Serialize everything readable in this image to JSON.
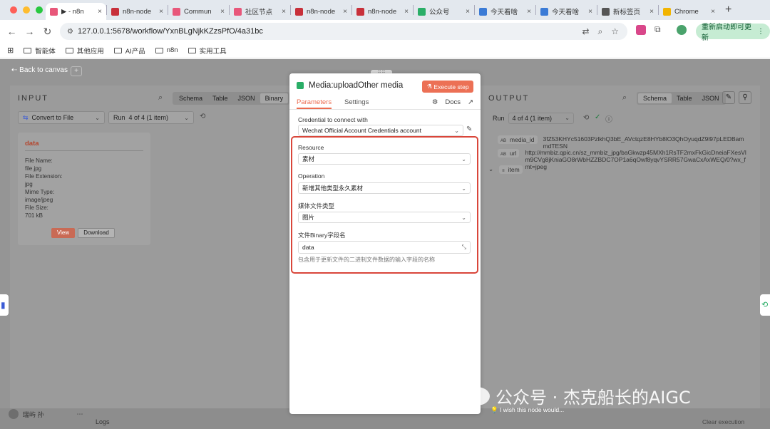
{
  "browser": {
    "tabs": [
      {
        "label": "▶ - n8n",
        "active": true,
        "icon": "n8n-icon"
      },
      {
        "label": "n8n-node",
        "active": false,
        "icon": "n8n-red-icon"
      },
      {
        "label": "Commun",
        "active": false,
        "icon": "n8n-icon"
      },
      {
        "label": "社区节点",
        "active": false,
        "icon": "n8n-icon"
      },
      {
        "label": "n8n-node",
        "active": false,
        "icon": "n8n-red-icon"
      },
      {
        "label": "n8n-node",
        "active": false,
        "icon": "n8n-red-icon"
      },
      {
        "label": "公众号",
        "active": false,
        "icon": "recycle-icon"
      },
      {
        "label": "今天看啥",
        "active": false,
        "icon": "blue-doc-icon"
      },
      {
        "label": "今天看啥",
        "active": false,
        "icon": "blue-doc-icon"
      },
      {
        "label": "新标签页",
        "active": false,
        "icon": "globe-icon"
      },
      {
        "label": "Chrome",
        "active": false,
        "icon": "chrome-icon"
      }
    ],
    "url": "127.0.0.1:5678/workflow/YxnBLgNjkKZzsPfO/4a31bc",
    "relaunch_label": "重新启动即可更新",
    "bookmarks": [
      "智能体",
      "其他应用",
      "AI产品",
      "n8n",
      "实用工具"
    ]
  },
  "canvas": {
    "back_label": "Back to canvas"
  },
  "input": {
    "title": "INPUT",
    "views": [
      "Schema",
      "Table",
      "JSON",
      "Binary"
    ],
    "selected_view": "Binary",
    "source_node": "Convert to File",
    "run_label": "Run",
    "run_value": "4 of 4 (1 item)",
    "binary": {
      "key": "data",
      "lines": [
        "File Name:",
        "file.jpg",
        "File Extension:",
        "jpg",
        "Mime Type:",
        "image/jpeg",
        "File Size:",
        "701 kB"
      ],
      "view_label": "View",
      "download_label": "Download"
    }
  },
  "node": {
    "title": "Media:uploadOther media",
    "execute_label": "Execute step",
    "tabs": [
      "Parameters",
      "Settings"
    ],
    "docs_label": "Docs",
    "credential_label": "Credential to connect with",
    "credential_value": "Wechat Official Account Credentials account",
    "resource_label": "Resource",
    "resource_value": "素材",
    "operation_label": "Operation",
    "operation_value": "新增其他类型永久素材",
    "media_type_label": "媒体文件类型",
    "media_type_value": "图片",
    "binary_field_label": "文件Binary字段名",
    "binary_field_value": "data",
    "binary_field_hint": "包含用于更新文件的二进制文件数据的输入字段的名称"
  },
  "output": {
    "title": "OUTPUT",
    "views": [
      "Schema",
      "Table",
      "JSON"
    ],
    "selected_view": "Schema",
    "run_label": "Run",
    "run_value": "4 of 4 (1 item)",
    "fields": [
      {
        "type": "AB",
        "key": "media_id",
        "value": "3fZ53KHYc51603PzlkhQ3bE_AVctqzE8HYb8lO3QhOyuqdZ9l97pLEDBammdTESN"
      },
      {
        "type": "AB",
        "key": "url",
        "value": "http://mmbiz.qpic.cn/sz_mmbiz_jpg/baGkwzp45MXh1RsTF2mxFkGicDneiaFXesVlm9CVg8jKniaGO8rWbHZZBDC7OP1a6qOwf8yqvYSRR57GwaCxAxWEQ/0?wx_fmt=jpeg"
      },
      {
        "type": "≡",
        "key": "item",
        "value": ""
      }
    ]
  },
  "footer": {
    "user": "瑞屿 孙",
    "logs": "Logs",
    "wish": "I wish this node would...",
    "clear": "Clear execution"
  },
  "watermark": "公众号 · 杰克船长的AIGC",
  "colors": {
    "accent": "#ec7055",
    "highlight_box": "#d9463a",
    "relaunch_bg": "#c6ecd3"
  }
}
